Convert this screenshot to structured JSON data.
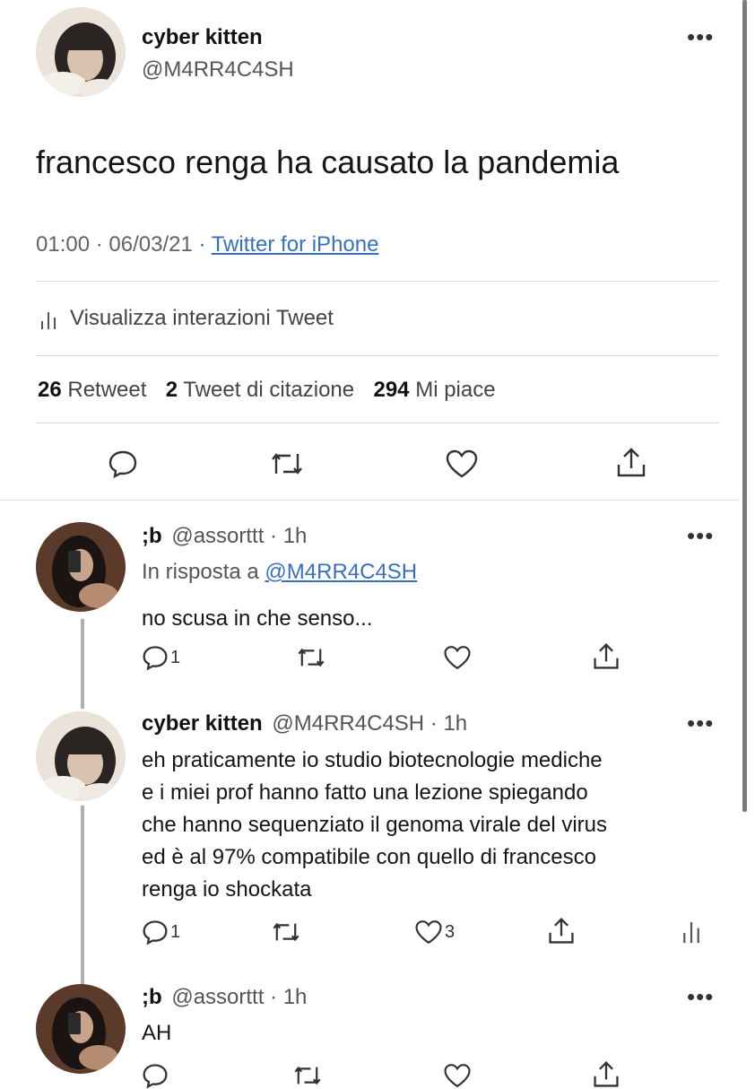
{
  "main_tweet": {
    "display_name": "cyber kitten",
    "handle": "@M4RR4C4SH",
    "text": "francesco renga ha causato la pandemia",
    "time": "01:00 · 06/03/21 · ",
    "source": "Twitter for iPhone",
    "interactions_label": "Visualizza interazioni Tweet",
    "retweet_count": "26",
    "retweet_label": "Retweet",
    "quote_count": "2",
    "quote_label": "Tweet di citazione",
    "like_count": "294",
    "like_label": "Mi piace"
  },
  "replies": [
    {
      "display_name": ";b",
      "meta": "@assorttt · 1h",
      "reply_to_prefix": "In risposta a ",
      "reply_to_handle": "@M4RR4C4SH",
      "text": "no scusa in che senso...",
      "reply_count": "1"
    },
    {
      "display_name": "cyber kitten",
      "meta": "@M4RR4C4SH · 1h",
      "lines": [
        "eh praticamente io studio biotecnologie mediche",
        "e i miei prof hanno fatto una lezione spiegando",
        "che hanno sequenziato il genoma virale del virus",
        "ed è al 97% compatibile con quello di francesco",
        "renga io shockata"
      ],
      "reply_count": "1",
      "like_count": "3"
    },
    {
      "display_name": ";b",
      "meta": "@assorttt · 1h",
      "text": "AH"
    }
  ],
  "icons": [
    "reply-icon",
    "retweet-icon",
    "like-icon",
    "share-icon",
    "analytics-icon",
    "more-icon"
  ]
}
